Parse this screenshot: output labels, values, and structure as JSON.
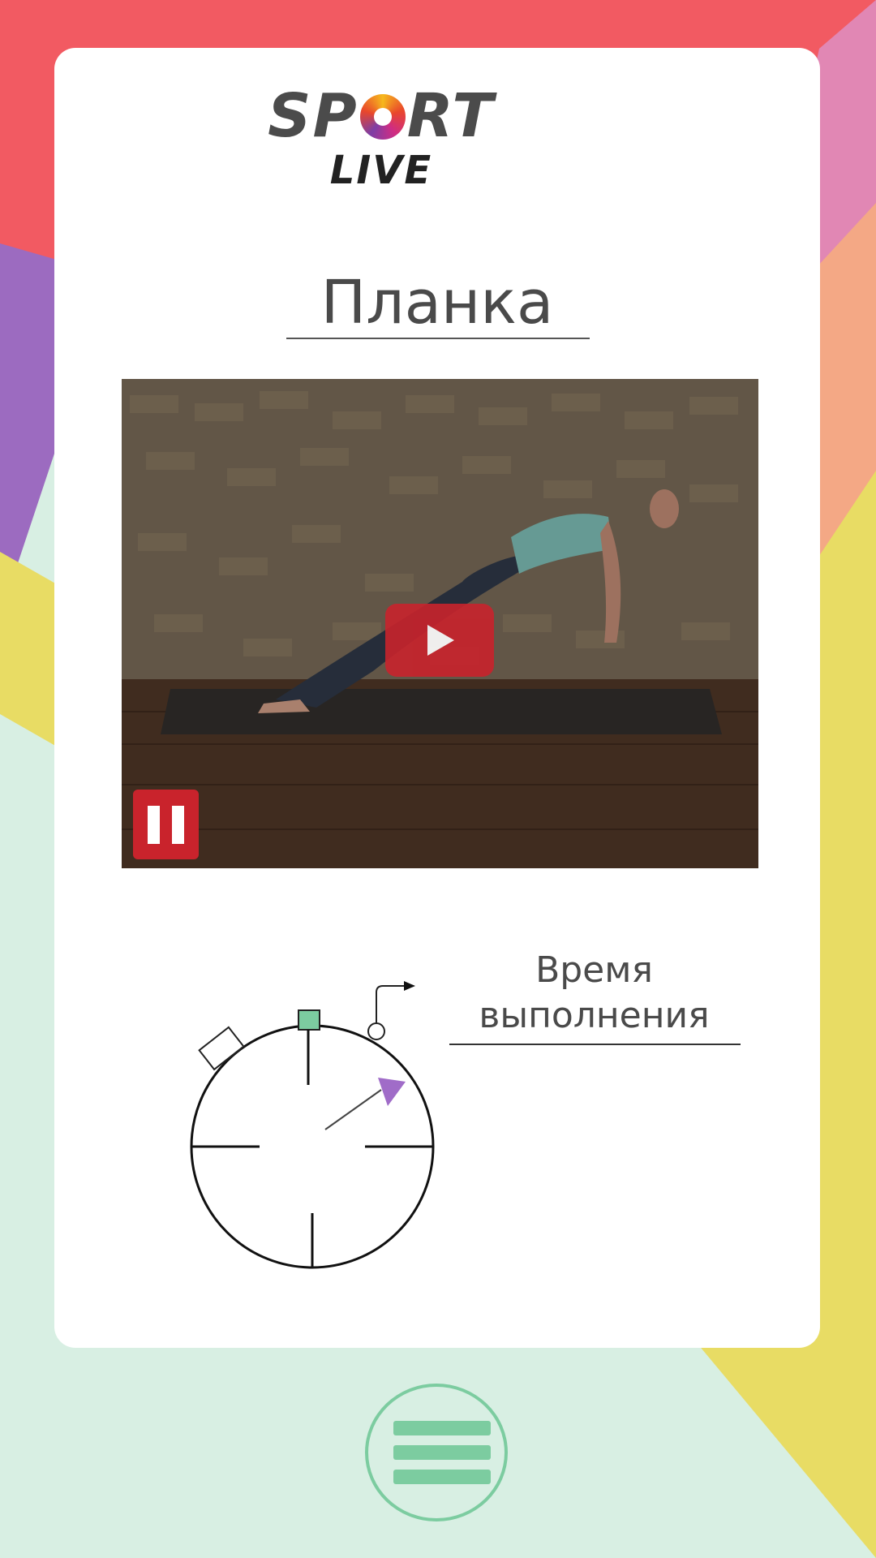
{
  "logo": {
    "sport_before": "SP",
    "sport_after": "RT",
    "live": "LIVE"
  },
  "exercise": {
    "title": "Планка"
  },
  "video": {
    "play_icon": "play-icon",
    "pause_icon": "pause-icon"
  },
  "timer": {
    "label_line1": "Время",
    "label_line2": "выполнения",
    "icon": "stopwatch-icon"
  },
  "menu": {
    "icon": "hamburger-menu-icon"
  },
  "colors": {
    "accent_red": "#c9232c",
    "accent_green": "#7ccca0",
    "accent_purple": "#a06cc8",
    "bg_coral": "#f25a62",
    "bg_pink": "#e187b4",
    "bg_peach": "#f4a885",
    "bg_yellow": "#e8dc64",
    "bg_mint": "#d8efe3",
    "bg_violet": "#9c6bc0"
  }
}
